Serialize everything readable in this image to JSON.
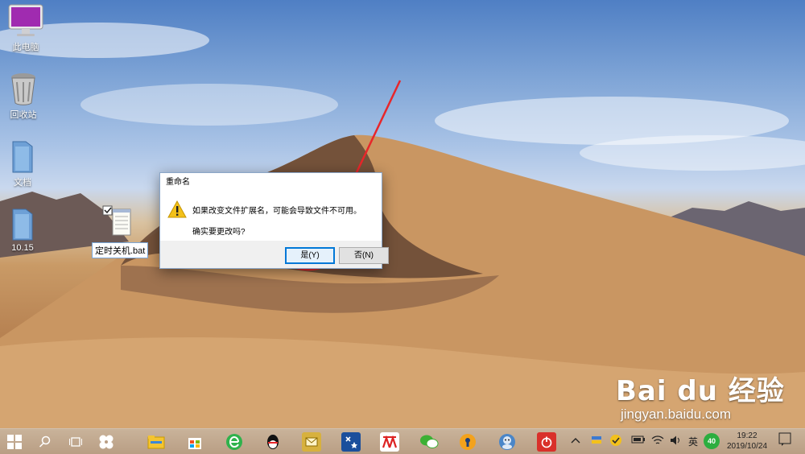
{
  "desktop": {
    "icons": [
      {
        "label": "此电脑",
        "icon": "computer-icon"
      },
      {
        "label": "回收站",
        "icon": "recycle-bin-icon"
      },
      {
        "label": "文档",
        "icon": "folder-icon"
      },
      {
        "label": "10.15",
        "icon": "folder-icon"
      }
    ],
    "file": {
      "label": "定时关机.bat",
      "icon": "notepad-file-icon",
      "selected": true
    }
  },
  "dialog": {
    "title": "重命名",
    "message": "如果改变文件扩展名，可能会导致文件不可用。",
    "question": "确实要更改吗?",
    "yes_label": "是(Y)",
    "no_label": "否(N)",
    "icon": "warning-icon"
  },
  "annotation": {
    "color": "#e8262a"
  },
  "taskbar": {
    "apps": [
      "file-explorer-icon",
      "store-icon",
      "browser-e-icon",
      "qq-icon",
      "mail-app-icon",
      "tool-app-icon",
      "office-app-icon",
      "wechat-icon",
      "keyhole-app-icon",
      "avatar-app-icon",
      "power-app-icon"
    ],
    "tray": {
      "ime": "英",
      "badge": "40"
    },
    "clock": {
      "time": "19:22",
      "date": "2019/10/24"
    }
  },
  "watermark": {
    "brand": "Bai du 经验",
    "site": "jingyan.baidu.com"
  }
}
